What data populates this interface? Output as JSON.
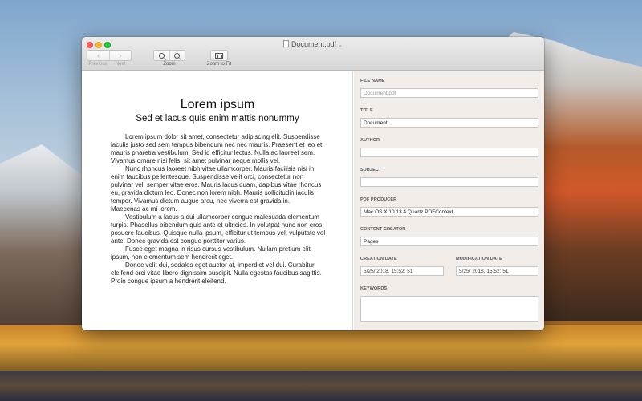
{
  "window": {
    "title": "Document.pdf"
  },
  "toolbar": {
    "previous_label": "Previous",
    "next_label": "Next",
    "zoom_label": "Zoom",
    "zoom_to_fit_label": "Zoom to Fit"
  },
  "document": {
    "title": "Lorem ipsum",
    "subtitle": "Sed et lacus quis enim mattis nonummy",
    "paragraphs": [
      "Lorem ipsum dolor sit amet, consectetur adipiscing elit. Suspendisse iaculis justo sed sem tempus bibendum nec nec mauris. Praesent et leo et mauris pharetra vestibulum. Sed id efficitur lectus. Nulla ac laoreet sem. Vivamus ornare nisi felis, sit amet pulvinar neque mollis vel.",
      "Nunc rhoncus laoreet nibh vitae ullamcorper. Mauris facilisis nisi in enim faucibus pellentesque. Suspendisse velit orci, consectetur non pulvinar vel, semper vitae eros. Mauris lacus quam, dapibus vitae rhoncus eu, gravida dictum leo. Donec non lorem nibh. Mauris sollicitudin iaculis tempor. Vivamus dictum augue arcu, nec viverra est gravida in.",
      "Maecenas ac mi lorem.",
      "Vestibulum a lacus a dui ullamcorper congue malesuada elementum turpis. Phasellus bibendum quis ante et ultricies. In volutpat nunc non eros posuere faucibus. Quisque nulla ipsum, efficitur ut tempus vel, vulputate vel ante. Donec gravida est congue porttitor varius.",
      "Fusce eget magna in risus cursus vestibulum. Nullam pretium elit ipsum, non elementum sem hendrerit eget.",
      "Donec velit dui, sodales eget auctor at, imperdiet vel dui. Curabitur eleifend orci vitae libero dignissim suscipit. Nulla egestas faucibus sagittis. Proin congue ipsum a hendrerit eleifend."
    ]
  },
  "inspector": {
    "file_name": {
      "label": "FILE NAME",
      "placeholder": "Document.pdf",
      "value": ""
    },
    "title": {
      "label": "TITLE",
      "value": "Document"
    },
    "author": {
      "label": "AUTHOR",
      "value": ""
    },
    "subject": {
      "label": "SUBJECT",
      "value": ""
    },
    "pdf_producer": {
      "label": "PDF PRODUCER",
      "value": "Mac OS X 10.13.4 Quartz PDFContext"
    },
    "content_creator": {
      "label": "CONTENT CREATOR",
      "value": "Pages"
    },
    "creation_date": {
      "label": "CREATION DATE",
      "value": "5/25/ 2018, 15:52: 51"
    },
    "modification_date": {
      "label": "MODIFICATION DATE",
      "value": "5/25/ 2018, 15:52: 51"
    },
    "keywords": {
      "label": "KEYWORDS",
      "value": ""
    }
  },
  "icons": {
    "document": "doc-icon",
    "title_menu": "chevron-down-icon",
    "previous": "chevron-left-icon",
    "next": "chevron-right-icon",
    "zoom_out": "zoom-out-icon",
    "zoom_in": "zoom-in-icon",
    "zoom_to_fit": "zoom-to-fit-icon"
  },
  "colors": {
    "close": "#fc5f57",
    "minimize": "#fdbc2e",
    "maximize": "#28c840"
  }
}
